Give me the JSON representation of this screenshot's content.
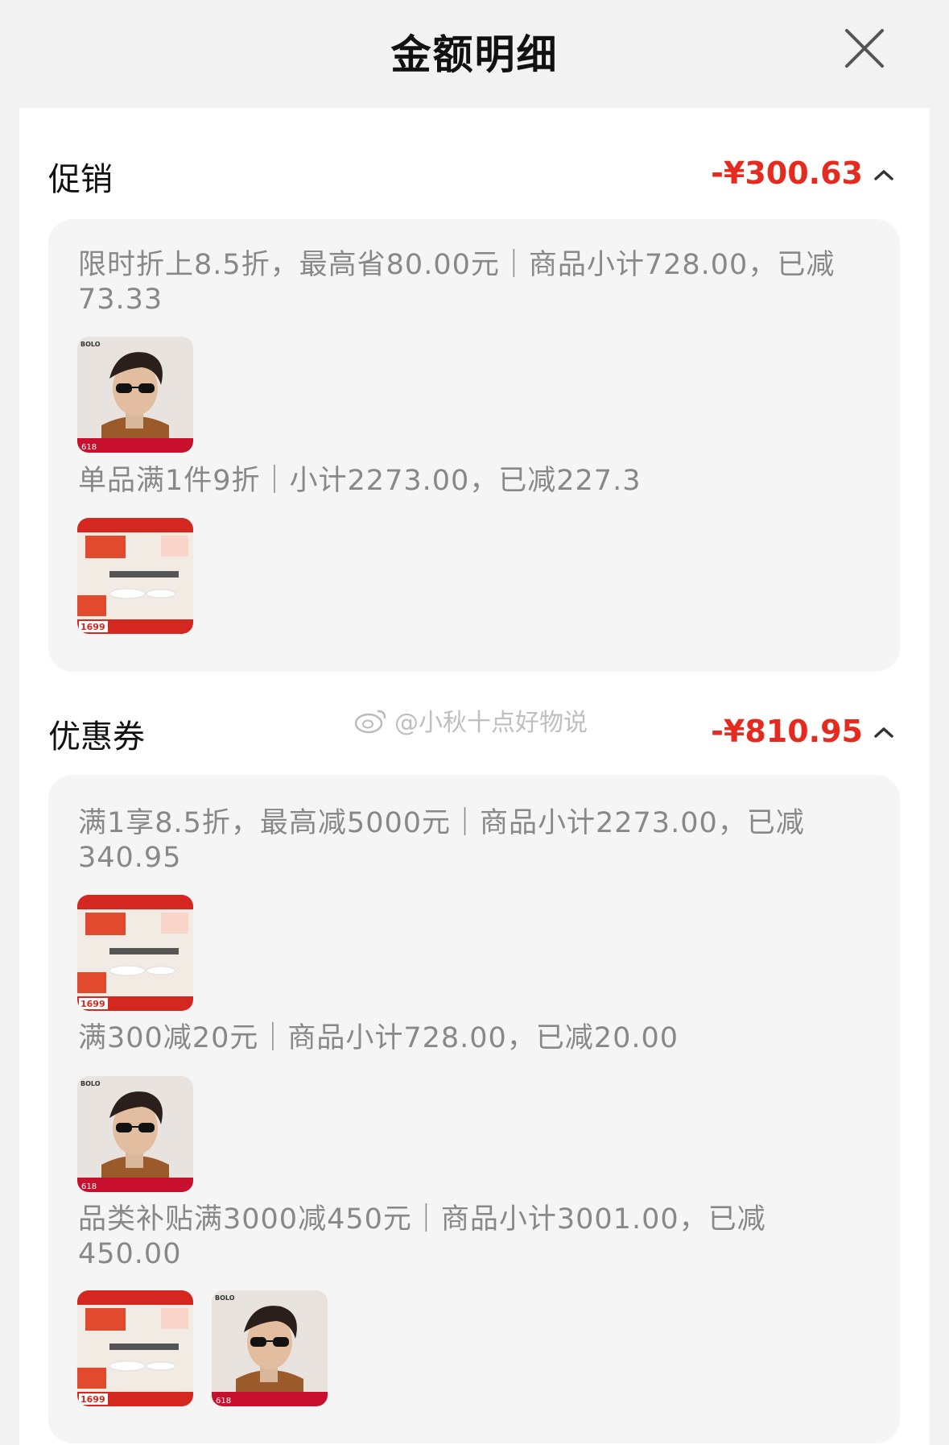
{
  "header": {
    "title": "金额明细",
    "close_icon": "close-icon"
  },
  "colors": {
    "accent_red": "#e52a1f",
    "muted_text": "#888888",
    "card_bg": "#f5f5f5"
  },
  "promotion": {
    "title": "促销",
    "amount": "-¥300.63",
    "rules": [
      {
        "line1": "限时折上8.5折，最高省80.00元｜商品小计728.00，已减",
        "line2": "73.33",
        "product_badge": "618"
      },
      {
        "line1": "单品满1件9折｜小计2273.00，已减227.3",
        "product_badge": "1699"
      }
    ]
  },
  "coupon": {
    "title": "优惠券",
    "amount": "-¥810.95",
    "rules": [
      {
        "line1": "满1享8.5折，最高减5000元｜商品小计2273.00，已减",
        "line2": "340.95",
        "product_badge": "1699"
      },
      {
        "line1": "满300减20元｜商品小计728.00，已减20.00",
        "product_badge": "618"
      },
      {
        "line1": "品类补贴满3000减450元｜商品小计3001.00，已减",
        "line2": "450.00",
        "product_badges": [
          "1699",
          "618"
        ]
      }
    ]
  },
  "watermark": "@小秋十点好物说"
}
